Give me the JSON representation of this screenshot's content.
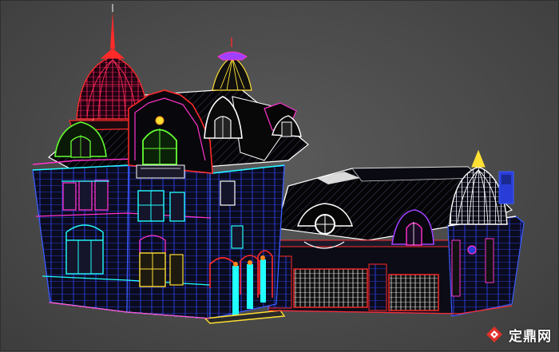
{
  "viewport": {
    "background": "#4a4a4a",
    "wire_colors": {
      "blue": "#3a5cff",
      "cyan": "#22ffff",
      "white": "#ffffff",
      "magenta": "#ff33cc",
      "red": "#ff2a2a",
      "yellow": "#ffe033",
      "green": "#66ff33",
      "purple": "#a040ff",
      "navy": "#1a2a90",
      "orange": "#ff8a1a"
    }
  },
  "subject": {
    "icon": "wireframe-villa-model"
  },
  "watermark": {
    "text": "定鼎网",
    "icon": "dingding-logo-icon",
    "color": "#e0312a"
  }
}
